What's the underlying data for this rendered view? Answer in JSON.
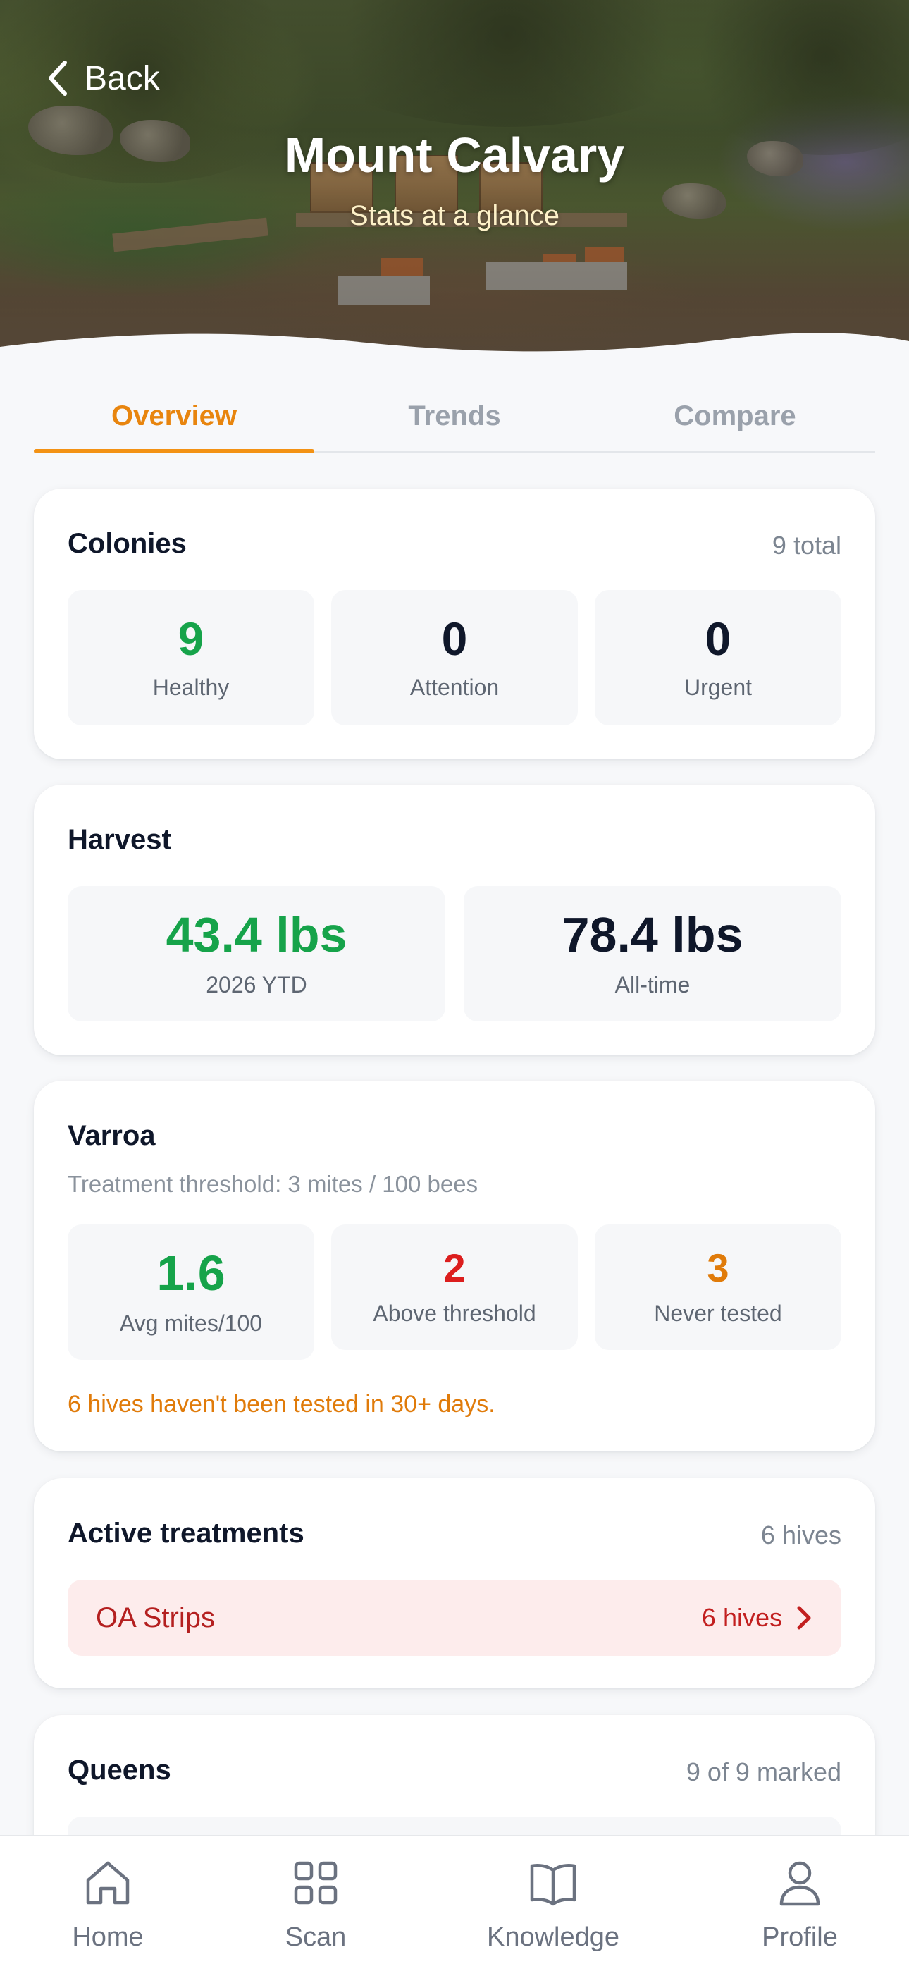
{
  "header": {
    "back_label": "Back",
    "title": "Mount Calvary",
    "subtitle": "Stats at a glance"
  },
  "tabs": [
    {
      "label": "Overview",
      "active": true
    },
    {
      "label": "Trends",
      "active": false
    },
    {
      "label": "Compare",
      "active": false
    }
  ],
  "colonies": {
    "title": "Colonies",
    "total": "9 total",
    "stats": [
      {
        "value": "9",
        "label": "Healthy"
      },
      {
        "value": "0",
        "label": "Attention"
      },
      {
        "value": "0",
        "label": "Urgent"
      }
    ]
  },
  "harvest": {
    "title": "Harvest",
    "stats": [
      {
        "value": "43.4 lbs",
        "label": "2026 YTD"
      },
      {
        "value": "78.4 lbs",
        "label": "All-time"
      }
    ]
  },
  "varroa": {
    "title": "Varroa",
    "threshold": "Treatment threshold: 3 mites / 100 bees",
    "stats": [
      {
        "value": "1.6",
        "label": "Avg mites/100"
      },
      {
        "value": "2",
        "label": "Above threshold"
      },
      {
        "value": "3",
        "label": "Never tested"
      }
    ],
    "warning": "6 hives haven't been tested in 30+ days."
  },
  "treatments": {
    "title": "Active treatments",
    "count": "6 hives",
    "items": [
      {
        "name": "OA Strips",
        "hives": "6 hives"
      }
    ]
  },
  "queens": {
    "title": "Queens",
    "marked": "9 of 9 marked"
  },
  "nav": [
    {
      "label": "Home",
      "icon": "home-icon"
    },
    {
      "label": "Scan",
      "icon": "grid-icon"
    },
    {
      "label": "Knowledge",
      "icon": "book-icon"
    },
    {
      "label": "Profile",
      "icon": "user-icon"
    }
  ],
  "colors": {
    "accent": "#f39214",
    "healthy": "#16a34a",
    "danger": "#dc1e1e",
    "warning": "#e07b0a",
    "treatment_bg": "#fdecec"
  }
}
